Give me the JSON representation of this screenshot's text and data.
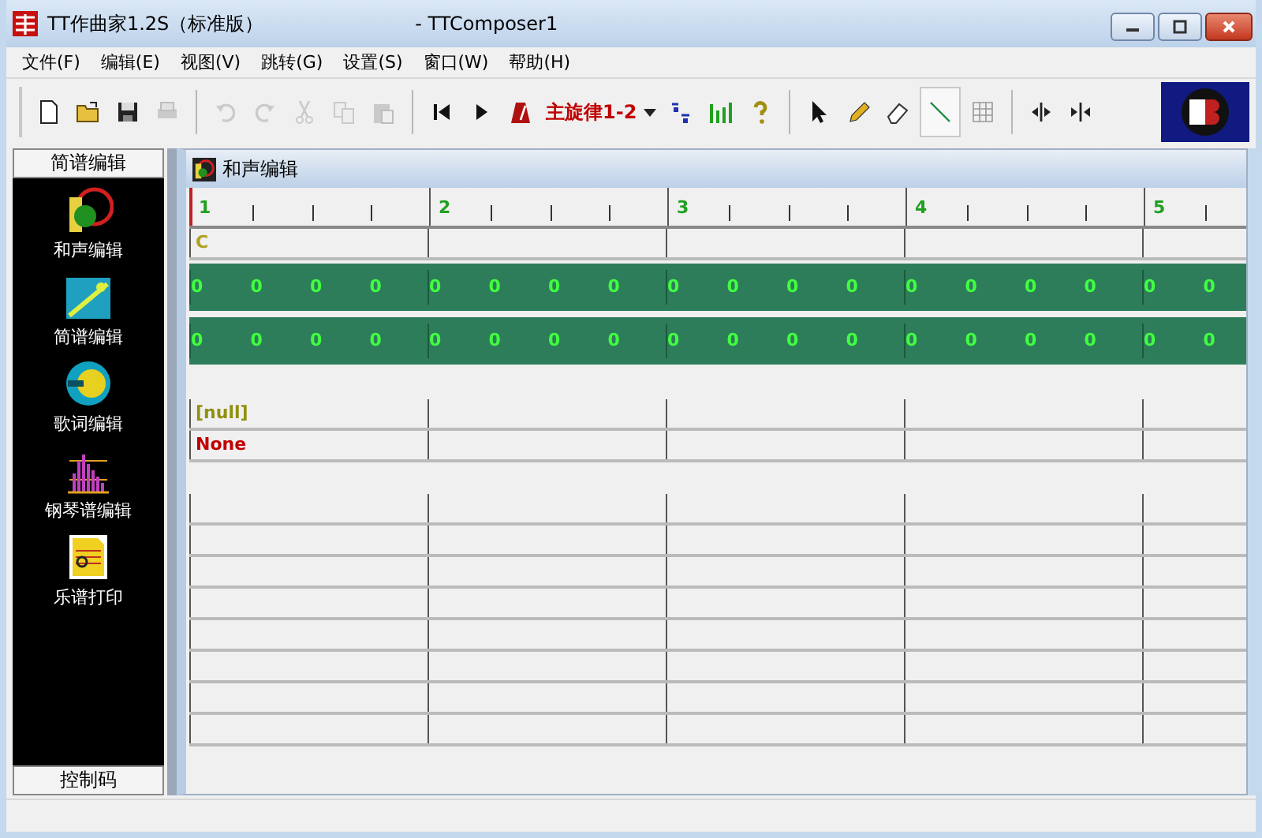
{
  "window": {
    "title": "TT作曲家1.2S（标准版）",
    "document": "- TTComposer1"
  },
  "menu": [
    "文件(F)",
    "编辑(E)",
    "视图(V)",
    "跳转(G)",
    "设置(S)",
    "窗口(W)",
    "帮助(H)"
  ],
  "toolbar": [
    {
      "kind": "new",
      "disabled": false
    },
    {
      "kind": "open",
      "disabled": false
    },
    {
      "kind": "save",
      "disabled": false
    },
    {
      "kind": "print",
      "disabled": true
    },
    {
      "kind": "sep"
    },
    {
      "kind": "undo",
      "disabled": true
    },
    {
      "kind": "redo",
      "disabled": true
    },
    {
      "kind": "cut",
      "disabled": true
    },
    {
      "kind": "copy",
      "disabled": true
    },
    {
      "kind": "paste",
      "disabled": true
    },
    {
      "kind": "sep"
    },
    {
      "kind": "first",
      "disabled": false
    },
    {
      "kind": "play",
      "disabled": false
    },
    {
      "kind": "metronome",
      "disabled": false
    },
    {
      "kind": "track",
      "label": "主旋律1-2"
    },
    {
      "kind": "notation",
      "disabled": false
    },
    {
      "kind": "bars",
      "disabled": false
    },
    {
      "kind": "help",
      "disabled": false
    },
    {
      "kind": "sep"
    },
    {
      "kind": "pointer",
      "selected": false
    },
    {
      "kind": "pencil",
      "selected": false
    },
    {
      "kind": "eraser",
      "selected": false
    },
    {
      "kind": "line",
      "selected": true
    },
    {
      "kind": "grid",
      "selected": false
    },
    {
      "kind": "sep"
    },
    {
      "kind": "split",
      "disabled": false
    },
    {
      "kind": "join",
      "disabled": false
    }
  ],
  "sidebar": {
    "header": "简谱编辑",
    "items": [
      {
        "kind": "harmony",
        "label": "和声编辑"
      },
      {
        "kind": "numbered",
        "label": "简谱编辑"
      },
      {
        "kind": "lyrics",
        "label": "歌词编辑"
      },
      {
        "kind": "piano",
        "label": "钢琴谱编辑"
      },
      {
        "kind": "print",
        "label": "乐谱打印"
      }
    ],
    "footer": "控制码"
  },
  "editor": {
    "title": "和声编辑",
    "measures": [
      "1",
      "2",
      "3",
      "4",
      "5"
    ],
    "rows": [
      {
        "kind": "chord",
        "text": "C"
      },
      {
        "kind": "beats",
        "beats": [
          "0",
          "0",
          "0",
          "0",
          "0",
          "0",
          "0",
          "0",
          "0",
          "0",
          "0",
          "0",
          "0",
          "0",
          "0",
          "0",
          "0",
          "0"
        ]
      },
      {
        "kind": "beats",
        "beats": [
          "0",
          "0",
          "0",
          "0",
          "0",
          "0",
          "0",
          "0",
          "0",
          "0",
          "0",
          "0",
          "0",
          "0",
          "0",
          "0",
          "0",
          "0"
        ]
      },
      {
        "kind": "gap"
      },
      {
        "kind": "lyric",
        "text": "[null]"
      },
      {
        "kind": "instrument",
        "text": "None"
      },
      {
        "kind": "gap"
      },
      {
        "kind": "empty"
      },
      {
        "kind": "empty"
      },
      {
        "kind": "empty"
      },
      {
        "kind": "empty"
      },
      {
        "kind": "empty"
      },
      {
        "kind": "empty"
      },
      {
        "kind": "empty"
      },
      {
        "kind": "empty"
      }
    ]
  }
}
